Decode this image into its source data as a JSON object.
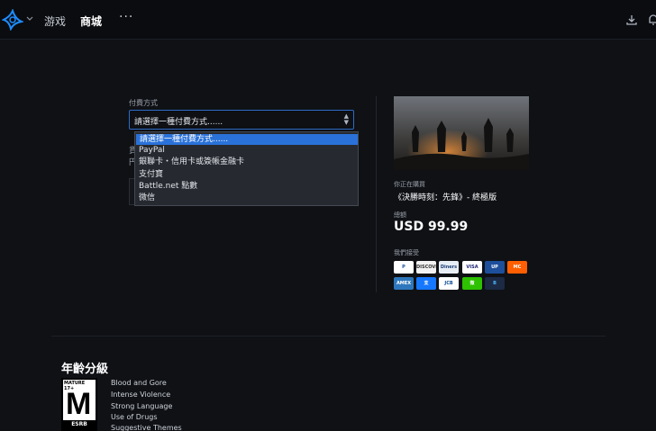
{
  "topbar": {
    "nav_games": "游戏",
    "nav_shop": "商城",
    "nav_more": "···"
  },
  "payment": {
    "label": "付費方式",
    "select_value": "請選擇一種付費方式......",
    "options": [
      "請選擇一種付費方式......",
      "PayPal",
      "銀聯卡・信用卡或簽帳金融卡",
      "支付寶",
      "Battle.net 點數",
      "微信"
    ],
    "partial_fragment_1": "貨",
    "partial_fragment_2": "円"
  },
  "purchase": {
    "buying_label": "你正在購買",
    "product_title": "《決勝時刻：先鋒》- 終極版",
    "amount_label": "總額",
    "price": "USD 99.99",
    "accept_label": "我們接受",
    "cards": [
      {
        "name": "paypal",
        "label": "P",
        "color": "#ffffff",
        "text": "#1b4ea3"
      },
      {
        "name": "discover",
        "label": "DISCOVER",
        "color": "#f2f2f2",
        "text": "#333333"
      },
      {
        "name": "diners",
        "label": "Diners",
        "color": "#e8eef5",
        "text": "#1b3f7a"
      },
      {
        "name": "visa",
        "label": "VISA",
        "color": "#ffffff",
        "text": "#1a1f71"
      },
      {
        "name": "unionpay",
        "label": "UP",
        "color": "#1d4f9b",
        "text": "#ffffff"
      },
      {
        "name": "mastercard",
        "label": "MC",
        "color": "#ff5f00",
        "text": "#ffffff"
      },
      {
        "name": "amex",
        "label": "AMEX",
        "color": "#2e77bc",
        "text": "#ffffff"
      },
      {
        "name": "alipay",
        "label": "支",
        "color": "#1677ff",
        "text": "#ffffff"
      },
      {
        "name": "jcb",
        "label": "JCB",
        "color": "#ffffff",
        "text": "#0e4c96"
      },
      {
        "name": "wechat",
        "label": "微",
        "color": "#2dc100",
        "text": "#ffffff"
      },
      {
        "name": "battlenet",
        "label": "B",
        "color": "#1c2a44",
        "text": "#46b7ff"
      }
    ]
  },
  "rating": {
    "title": "年齡分級",
    "esrb_top": "MATURE 17+",
    "esrb_letter": "M",
    "esrb_bottom": "ESRB",
    "descriptors": [
      "Blood and Gore",
      "Intense Violence",
      "Strong Language",
      "Use of Drugs",
      "Suggestive Themes"
    ]
  },
  "colors": {
    "accent": "#2a72d9",
    "background": "#0f1115"
  }
}
